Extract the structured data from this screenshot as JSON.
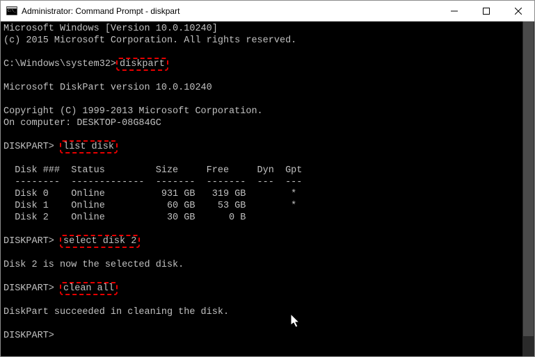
{
  "titlebar": {
    "text": "Administrator: Command Prompt - diskpart"
  },
  "lines": {
    "l0": "Microsoft Windows [Version 10.0.10240]",
    "l1": "(c) 2015 Microsoft Corporation. All rights reserved.",
    "l2": "",
    "prompt1_prefix": "C:\\Windows\\system32>",
    "cmd1": "diskpart",
    "l4": "",
    "l5": "Microsoft DiskPart version 10.0.10240",
    "l6": "",
    "l7": "Copyright (C) 1999-2013 Microsoft Corporation.",
    "l8": "On computer: DESKTOP-08G84GC",
    "l9": "",
    "prompt2_prefix": "DISKPART> ",
    "cmd2": "list disk",
    "l11": "",
    "l12": "  Disk ###  Status         Size     Free     Dyn  Gpt",
    "l13": "  --------  -------------  -------  -------  ---  ---",
    "l14": "  Disk 0    Online          931 GB   319 GB        *",
    "l15": "  Disk 1    Online           60 GB    53 GB        *",
    "l16": "  Disk 2    Online           30 GB      0 B",
    "l17": "",
    "prompt3_prefix": "DISKPART> ",
    "cmd3": "select disk 2",
    "l19": "",
    "l20": "Disk 2 is now the selected disk.",
    "l21": "",
    "prompt4_prefix": "DISKPART> ",
    "cmd4": "clean all",
    "l23": "",
    "l24": "DiskPart succeeded in cleaning the disk.",
    "l25": "",
    "prompt5": "DISKPART>",
    "l27": ""
  }
}
